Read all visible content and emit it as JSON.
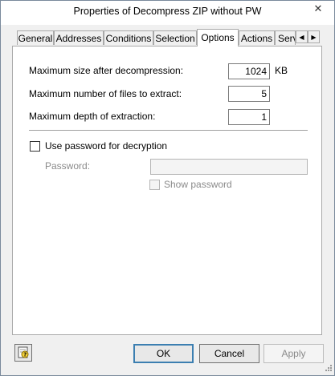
{
  "window": {
    "title": "Properties of Decompress ZIP without PW",
    "close_glyph": "✕"
  },
  "tabs": [
    {
      "label": "General"
    },
    {
      "label": "Addresses"
    },
    {
      "label": "Conditions"
    },
    {
      "label": "Selection"
    },
    {
      "label": "Options",
      "active": true
    },
    {
      "label": "Actions"
    },
    {
      "label": "Serv"
    }
  ],
  "tab_scroll": {
    "left_glyph": "◀",
    "right_glyph": "▶"
  },
  "options": {
    "max_size_label": "Maximum size after decompression:",
    "max_size_value": "1024",
    "max_size_unit": "KB",
    "max_files_label": "Maximum number of files to extract:",
    "max_files_value": "5",
    "max_depth_label": "Maximum depth of extraction:",
    "max_depth_value": "1",
    "use_password_label": "Use password for decryption",
    "use_password_checked": false,
    "password_label": "Password:",
    "password_value": "",
    "show_password_label": "Show password",
    "show_password_checked": false
  },
  "footer": {
    "help_icon": "help-icon",
    "ok_label": "OK",
    "cancel_label": "Cancel",
    "apply_label": "Apply"
  }
}
